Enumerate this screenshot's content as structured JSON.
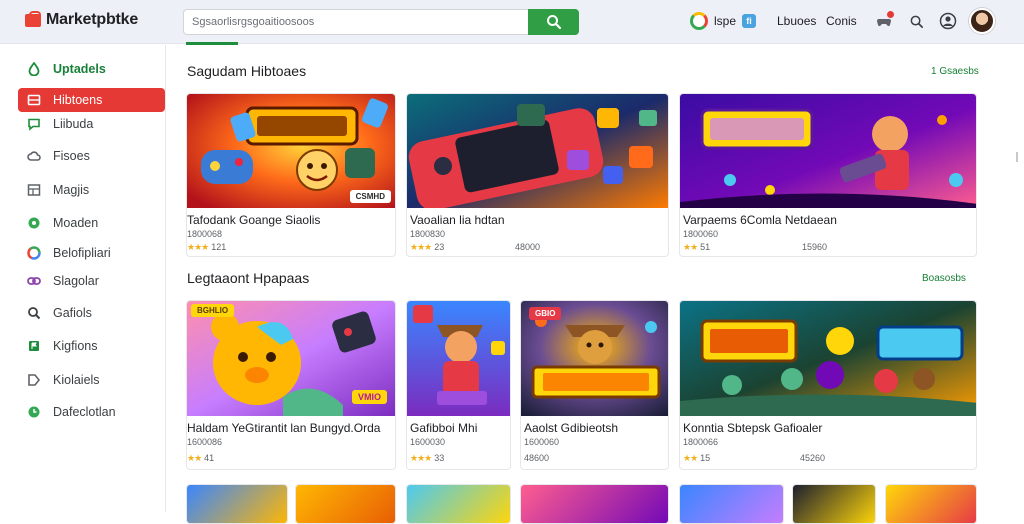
{
  "app": {
    "title": "Marketpbtke"
  },
  "search": {
    "placeholder": "Sgsaorlisrgsgoaitioosoos"
  },
  "header": {
    "lang_label": "lspe",
    "lang_badge": "fi",
    "nav_1": "Lbuoes",
    "nav_2": "Conis"
  },
  "sidebar": {
    "items": [
      {
        "label": "Uptadels",
        "icon": "drop-icon",
        "state": "current"
      },
      {
        "label": "Hibtoens",
        "icon": "grid-icon",
        "state": "active"
      },
      {
        "label": "Liibuda",
        "icon": "chat-icon",
        "state": "normal"
      },
      {
        "label": "Fisoes",
        "icon": "cloud-icon",
        "state": "normal"
      },
      {
        "label": "Magjis",
        "icon": "table-icon",
        "state": "normal"
      },
      {
        "label": "Moaden",
        "icon": "circle-icon",
        "state": "normal"
      },
      {
        "label": "Belofipliari",
        "icon": "chrome-icon",
        "state": "normal"
      },
      {
        "label": "Slagolar",
        "icon": "link-icon",
        "state": "normal"
      },
      {
        "label": "Gafiols",
        "icon": "search-icon",
        "state": "normal"
      },
      {
        "label": "Kigfions",
        "icon": "flag-icon",
        "state": "normal"
      },
      {
        "label": "Kiolaiels",
        "icon": "tag-icon",
        "state": "normal"
      },
      {
        "label": "Dafeclotlan",
        "icon": "clock-icon",
        "state": "normal"
      }
    ]
  },
  "sections": [
    {
      "title": "Sagudam Hibtoaes",
      "see_all": "1 Gsaesbs",
      "cards": [
        {
          "title": "Tafodank Goange Siaolis",
          "meta": "1800068",
          "stars": "★★★",
          "rating": "121",
          "count": "",
          "tag": "CSMHD"
        },
        {
          "title": "Vaoalian lia hdtan",
          "meta": "1800830",
          "stars": "★★★",
          "rating": "23",
          "count": "48000",
          "tag": ""
        },
        {
          "title": "Varpaems 6Comla Netdaean",
          "meta": "1800060",
          "stars": "★★",
          "rating": "51",
          "count": "15960",
          "tag": ""
        }
      ]
    },
    {
      "title": "Legtaaont Hpapaas",
      "see_all": "Boasosbs",
      "cards": [
        {
          "title": "Haldam YeGtirantit lan Bungyd.Orda",
          "meta": "1600086",
          "stars": "★★",
          "rating": "41",
          "count": "",
          "tag": "VMIO",
          "tag2": "BGHLIO"
        },
        {
          "title": "Gafibboi Mhi",
          "meta": "1600030",
          "stars": "★★★",
          "rating": "33",
          "count": "",
          "tag": ""
        },
        {
          "title": "Aaolst Gdibieotsh",
          "meta": "1600060",
          "stars": "",
          "rating": "",
          "count": "48600",
          "tag": "GBIO"
        },
        {
          "title": "Konntia Sbtepsk Gafioaler",
          "meta": "1800066",
          "stars": "★★",
          "rating": "15",
          "count": "45260",
          "tag": ""
        }
      ]
    }
  ],
  "colors": {
    "accent_red": "#e53935",
    "accent_green": "#2f9e44",
    "header_bg": "#eef0f8"
  }
}
